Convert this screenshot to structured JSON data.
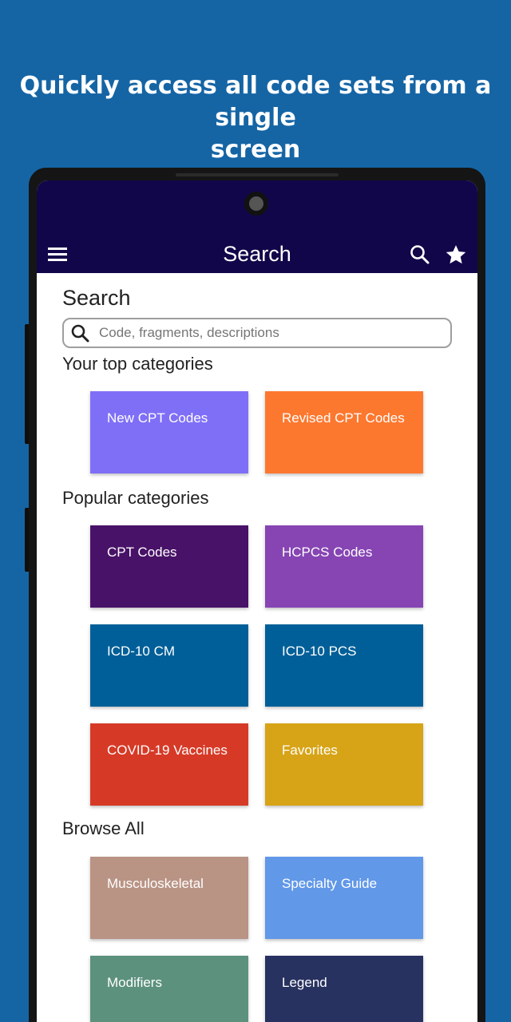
{
  "promo": {
    "line1": "Quickly access all code sets from a single",
    "line2": "screen"
  },
  "appbar": {
    "title": "Search",
    "menu_icon": "hamburger-menu-icon",
    "search_icon": "search-icon",
    "favorite_icon": "star-icon"
  },
  "search": {
    "heading": "Search",
    "placeholder": "Code, fragments, descriptions",
    "value": ""
  },
  "sections": {
    "top": "Your top categories",
    "popular": "Popular categories",
    "browse": "Browse All"
  },
  "top_categories": [
    {
      "label": "New CPT Codes",
      "color": "#7f6ff7"
    },
    {
      "label": "Revised CPT Codes",
      "color": "#fd782f"
    }
  ],
  "popular_categories": [
    {
      "label": "CPT Codes",
      "color": "#481268"
    },
    {
      "label": "HCPCS Codes",
      "color": "#8645b3"
    },
    {
      "label": "ICD-10 CM",
      "color": "#005f98"
    },
    {
      "label": "ICD-10 PCS",
      "color": "#005f98"
    },
    {
      "label": "COVID-19 Vaccines",
      "color": "#d63a27"
    },
    {
      "label": "Favorites",
      "color": "#d7a417"
    }
  ],
  "browse_all": [
    {
      "label": "Musculoskeletal",
      "color": "#b99384"
    },
    {
      "label": "Specialty Guide",
      "color": "#6198e8"
    },
    {
      "label": "Modifiers",
      "color": "#5c917d"
    },
    {
      "label": "Legend",
      "color": "#283260"
    }
  ],
  "colors": {
    "background": "#1565a5",
    "appbar": "#12064a"
  }
}
